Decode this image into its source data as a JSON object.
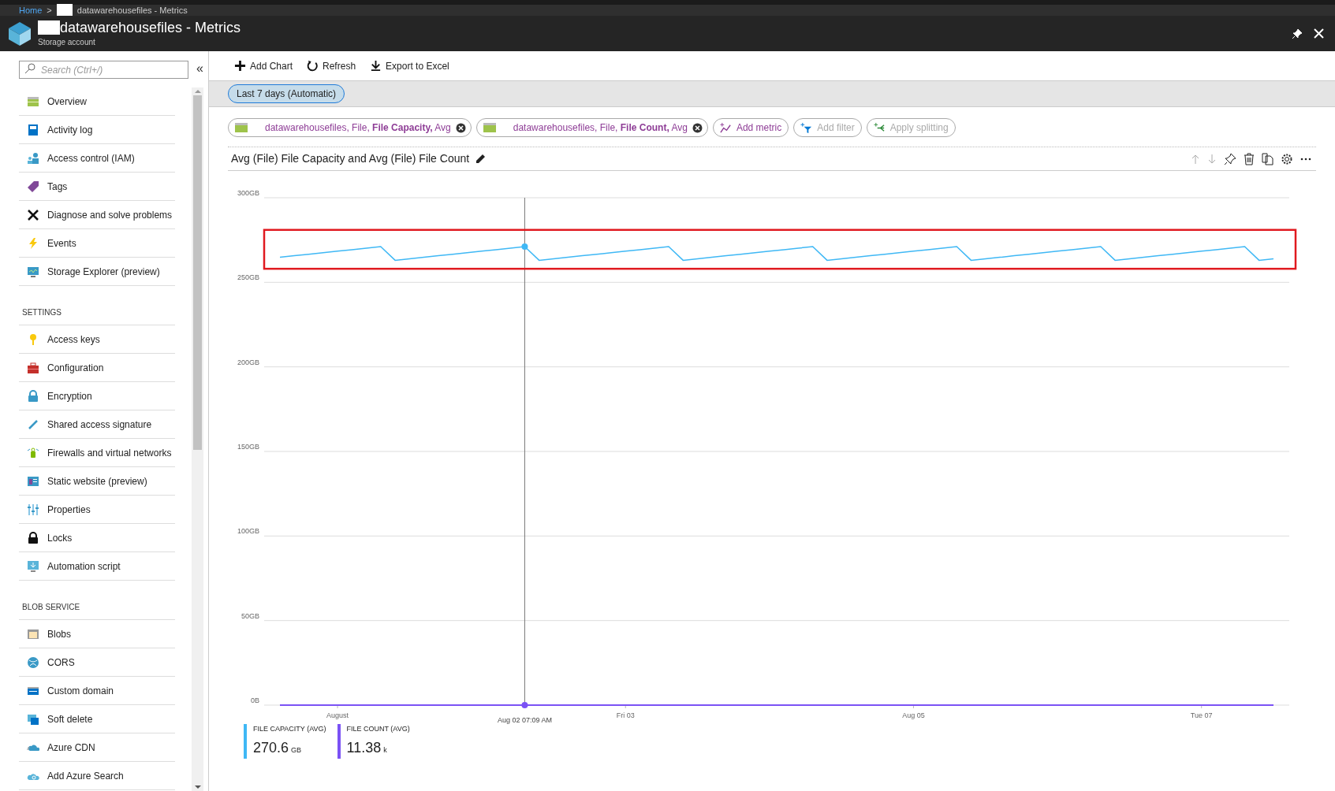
{
  "breadcrumb": {
    "home": "Home",
    "separator": ">",
    "current": "datawarehousefiles - Metrics"
  },
  "header": {
    "title": "datawarehousefiles - Metrics",
    "subtitle": "Storage account"
  },
  "sidebar": {
    "search": {
      "placeholder": "Search (Ctrl+/)"
    },
    "collapse": "«",
    "sections": [
      {
        "items": [
          {
            "label": "Overview"
          },
          {
            "label": "Activity log"
          },
          {
            "label": "Access control (IAM)"
          },
          {
            "label": "Tags"
          },
          {
            "label": "Diagnose and solve problems"
          },
          {
            "label": "Events"
          },
          {
            "label": "Storage Explorer (preview)"
          }
        ]
      },
      {
        "heading": "SETTINGS",
        "items": [
          {
            "label": "Access keys"
          },
          {
            "label": "Configuration"
          },
          {
            "label": "Encryption"
          },
          {
            "label": "Shared access signature"
          },
          {
            "label": "Firewalls and virtual networks"
          },
          {
            "label": "Static website (preview)"
          },
          {
            "label": "Properties"
          },
          {
            "label": "Locks"
          },
          {
            "label": "Automation script"
          }
        ]
      },
      {
        "heading": "BLOB SERVICE",
        "items": [
          {
            "label": "Blobs"
          },
          {
            "label": "CORS"
          },
          {
            "label": "Custom domain"
          },
          {
            "label": "Soft delete"
          },
          {
            "label": "Azure CDN"
          },
          {
            "label": "Add Azure Search"
          }
        ]
      }
    ]
  },
  "toolbar": [
    "Add Chart",
    "Refresh",
    "Export to Excel"
  ],
  "time_range": "Last 7 days (Automatic)",
  "metrics": [
    {
      "text": "datawarehousefiles, File, **File Capacity,** Avg"
    },
    {
      "text": "datawarehousefiles, File, **File Count,** Avg"
    }
  ],
  "metric_actions": [
    {
      "label": "Add metric",
      "disabled": false
    },
    {
      "label": "Add filter",
      "disabled": true
    },
    {
      "label": "Apply splitting",
      "disabled": true
    }
  ],
  "chart": {
    "title": "Avg (File) File Capacity and Avg (File) File Count",
    "cursor_label": "Aug 02 07:09 AM",
    "chart_data": {
      "type": "line",
      "grid": true,
      "ylim": [
        0,
        300
      ],
      "yticks": [
        {
          "value": 0,
          "label": "0B"
        },
        {
          "value": 50,
          "label": "50GB"
        },
        {
          "value": 100,
          "label": "100GB"
        },
        {
          "value": 150,
          "label": "150GB"
        },
        {
          "value": 200,
          "label": "200GB"
        },
        {
          "value": 250,
          "label": "250GB"
        },
        {
          "value": 300,
          "label": "300GB"
        }
      ],
      "categories": [
        null,
        null,
        null,
        null,
        "August",
        null,
        null,
        null,
        null,
        null,
        null,
        null,
        null,
        null,
        null,
        null,
        null,
        null,
        null,
        null,
        null,
        null,
        null,
        null,
        "Fri 03",
        null,
        null,
        null,
        null,
        null,
        null,
        null,
        null,
        null,
        null,
        null,
        null,
        null,
        null,
        null,
        null,
        null,
        null,
        null,
        "Aug 05",
        null,
        null,
        null,
        null,
        null,
        null,
        null,
        null,
        null,
        null,
        null,
        null,
        null,
        null,
        null,
        null,
        null,
        null,
        null,
        "Tue 07",
        null,
        null,
        null,
        null,
        null
      ],
      "series": [
        {
          "name": "FILE CAPACITY (AVG)",
          "color": "#3fb8f5",
          "values": [
            264.8,
            265.7,
            266.6,
            267.5,
            268.4,
            269.3,
            270.2,
            271.1,
            263.0,
            263.9,
            264.8,
            265.7,
            266.6,
            267.5,
            268.4,
            269.3,
            270.2,
            271.1,
            263.0,
            263.9,
            264.8,
            265.7,
            266.6,
            267.5,
            268.4,
            269.3,
            270.2,
            271.1,
            263.0,
            263.9,
            264.8,
            265.7,
            266.6,
            267.5,
            268.4,
            269.3,
            270.2,
            271.1,
            263.0,
            263.9,
            264.8,
            265.7,
            266.6,
            267.5,
            268.4,
            269.3,
            270.2,
            271.1,
            263.0,
            263.9,
            264.8,
            265.7,
            266.6,
            267.5,
            268.4,
            269.3,
            270.2,
            271.1,
            263.0,
            263.9,
            264.8,
            265.7,
            266.6,
            267.5,
            268.4,
            269.3,
            270.2,
            271.1,
            263.0,
            263.9
          ]
        },
        {
          "name": "FILE COUNT (AVG)",
          "color": "#7b52f5",
          "values": [
            0,
            0,
            0,
            0,
            0,
            0,
            0,
            0,
            0,
            0,
            0,
            0,
            0,
            0,
            0,
            0,
            0,
            0,
            0,
            0,
            0,
            0,
            0,
            0,
            0,
            0,
            0,
            0,
            0,
            0,
            0,
            0,
            0,
            0,
            0,
            0,
            0,
            0,
            0,
            0,
            0,
            0,
            0,
            0,
            0,
            0,
            0,
            0,
            0,
            0,
            0,
            0,
            0,
            0,
            0,
            0,
            0,
            0,
            0,
            0,
            0,
            0,
            0,
            0,
            0,
            0,
            0,
            0,
            0,
            0
          ]
        }
      ]
    },
    "legend": [
      {
        "value": "270.6",
        "unit": "GB"
      },
      {
        "value": "11.38",
        "unit": "k"
      }
    ]
  }
}
